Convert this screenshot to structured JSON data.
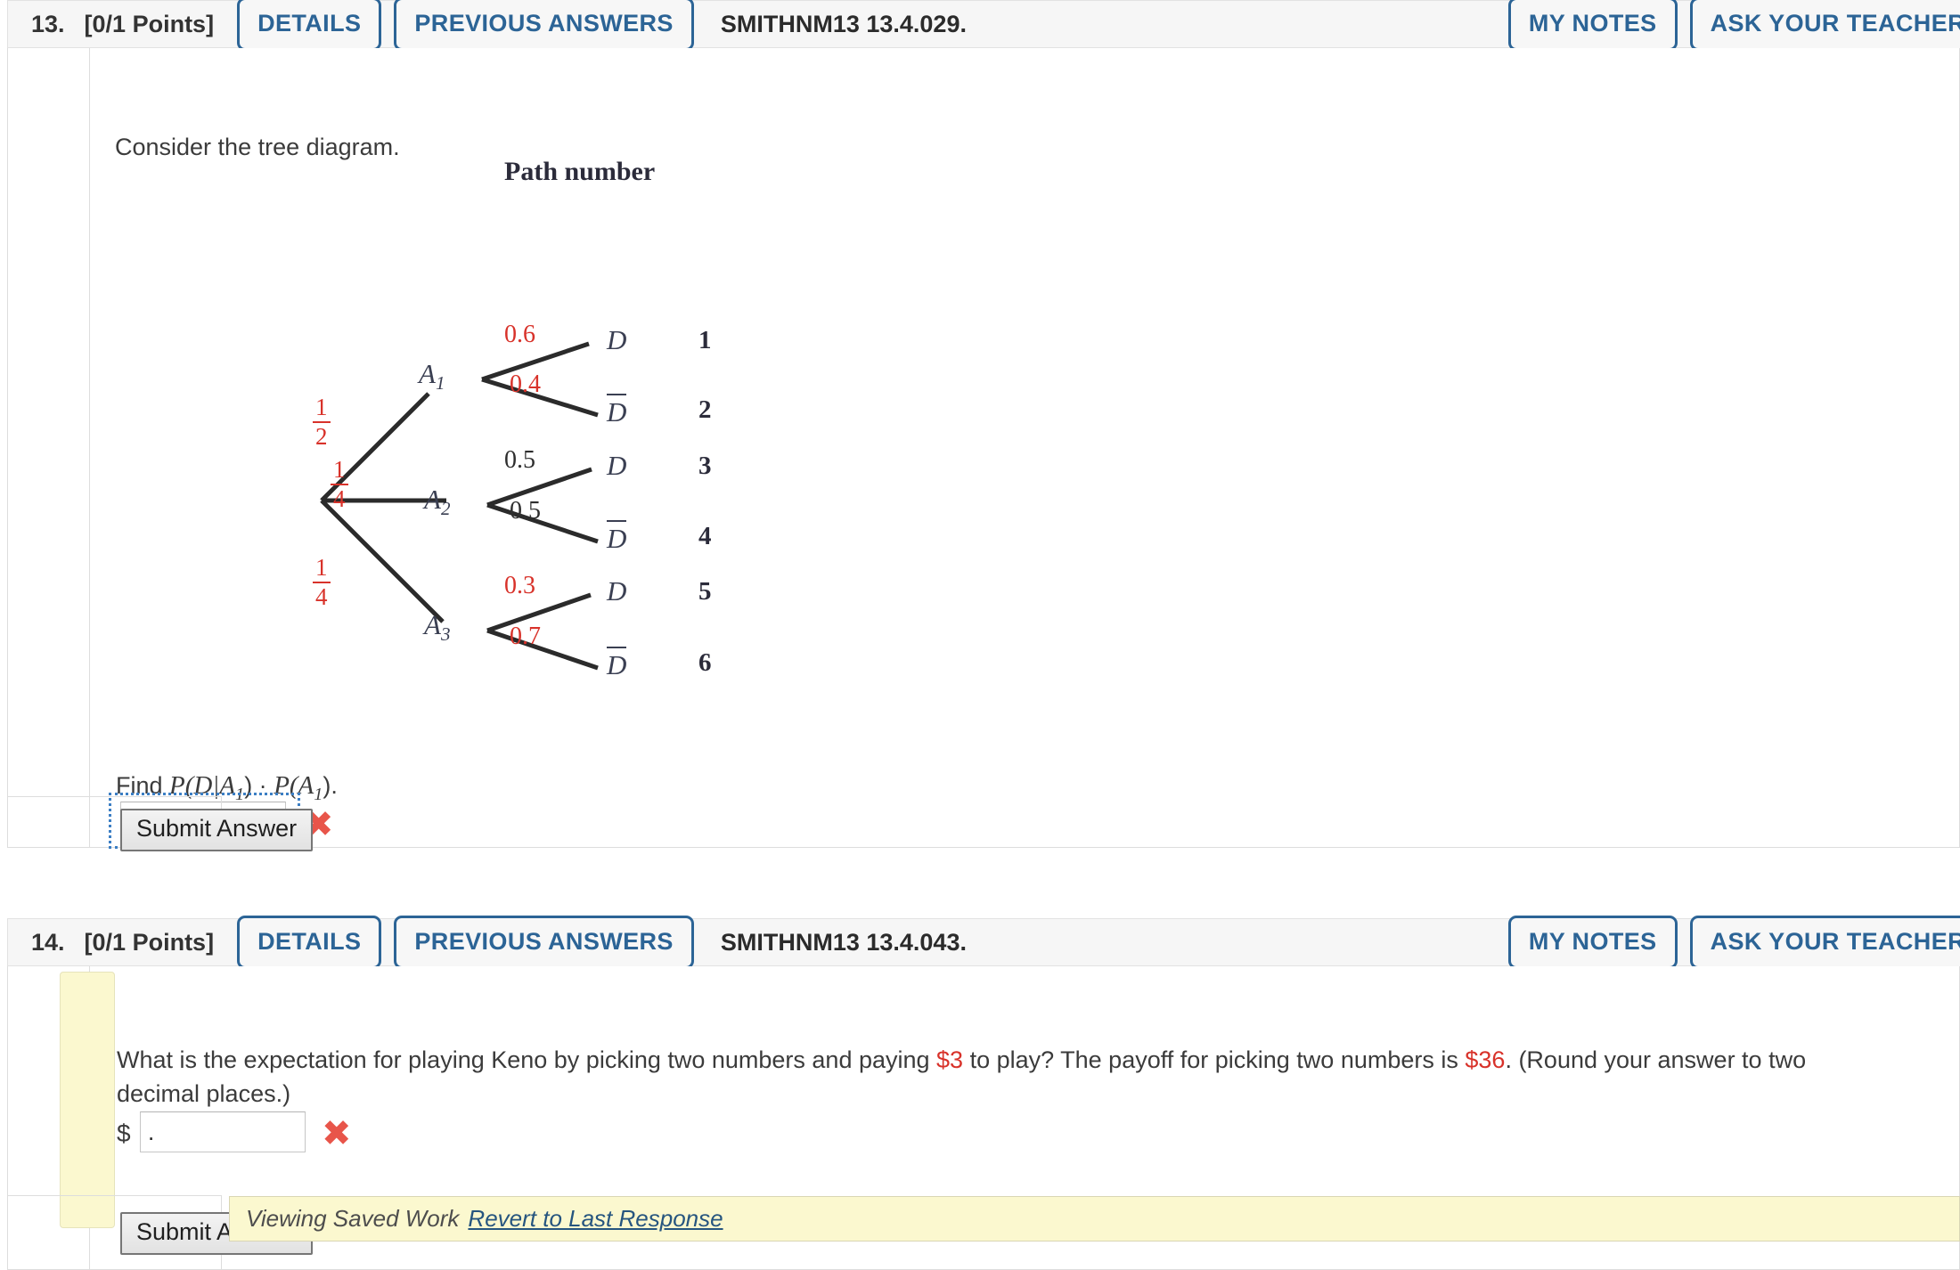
{
  "questions": [
    {
      "number": "13.",
      "points": "[0/1 Points]",
      "details_label": "DETAILS",
      "previous_answers_label": "PREVIOUS ANSWERS",
      "code": "SMITHNM13 13.4.029.",
      "my_notes_label": "MY NOTES",
      "ask_teacher_label": "ASK YOUR TEACHER",
      "prompt": "Consider the tree diagram.",
      "find_prefix": "Find ",
      "find_expr_1": "P(D|A",
      "find_sub_1": "1",
      "find_mid": ") · ",
      "find_expr_2": "P(A",
      "find_sub_2": "1",
      "find_suffix": ").",
      "answer_value": "",
      "wrong_mark": "✖",
      "submit_label": "Submit Answer"
    },
    {
      "number": "14.",
      "points": "[0/1 Points]",
      "details_label": "DETAILS",
      "previous_answers_label": "PREVIOUS ANSWERS",
      "code": "SMITHNM13 13.4.043.",
      "my_notes_label": "MY NOTES",
      "ask_teacher_label": "ASK YOUR TEACHER",
      "prompt_part_1": "What is the expectation for playing Keno by picking two numbers and paying ",
      "prompt_cost": "$3",
      "prompt_part_2": " to play? The payoff for picking two numbers is ",
      "prompt_payoff": "$36",
      "prompt_part_3": ". (Round your answer to two decimal places.)",
      "dollar_label": "$",
      "answer_value": ".",
      "wrong_mark": "✖",
      "submit_label": "Submit Answer",
      "saved_work_label": "Viewing Saved Work",
      "revert_link_label": "Revert to Last Response"
    }
  ],
  "chart_data": {
    "type": "diagram",
    "title": "Path number",
    "root_label": "",
    "branches": [
      {
        "node": "A",
        "node_sub": "1",
        "prior_num": "1",
        "prior_den": "2",
        "prior_color": "#d8322a",
        "children": [
          {
            "label": "D",
            "overline": false,
            "prob": "0.6",
            "prob_color": "#d8322a",
            "path": "1"
          },
          {
            "label": "D",
            "overline": true,
            "prob": "0.4",
            "prob_color": "#d8322a",
            "path": "2"
          }
        ]
      },
      {
        "node": "A",
        "node_sub": "2",
        "prior_num": "1",
        "prior_den": "4",
        "prior_color": "#d8322a",
        "children": [
          {
            "label": "D",
            "overline": false,
            "prob": "0.5",
            "prob_color": "#2e2e2e",
            "path": "3"
          },
          {
            "label": "D",
            "overline": true,
            "prob": "0.5",
            "prob_color": "#2e2e2e",
            "path": "4"
          }
        ]
      },
      {
        "node": "A",
        "node_sub": "3",
        "prior_num": "1",
        "prior_den": "4",
        "prior_color": "#d8322a",
        "children": [
          {
            "label": "D",
            "overline": false,
            "prob": "0.3",
            "prob_color": "#d8322a",
            "path": "5"
          },
          {
            "label": "D",
            "overline": true,
            "prob": "0.7",
            "prob_color": "#d8322a",
            "path": "6"
          }
        ]
      }
    ]
  },
  "colors": {
    "accent_blue": "#2c6496",
    "error_red": "#e8554a",
    "prob_red": "#d8322a",
    "header_bg": "#f6f6f6",
    "saved_yellow": "#fbf8cf"
  }
}
